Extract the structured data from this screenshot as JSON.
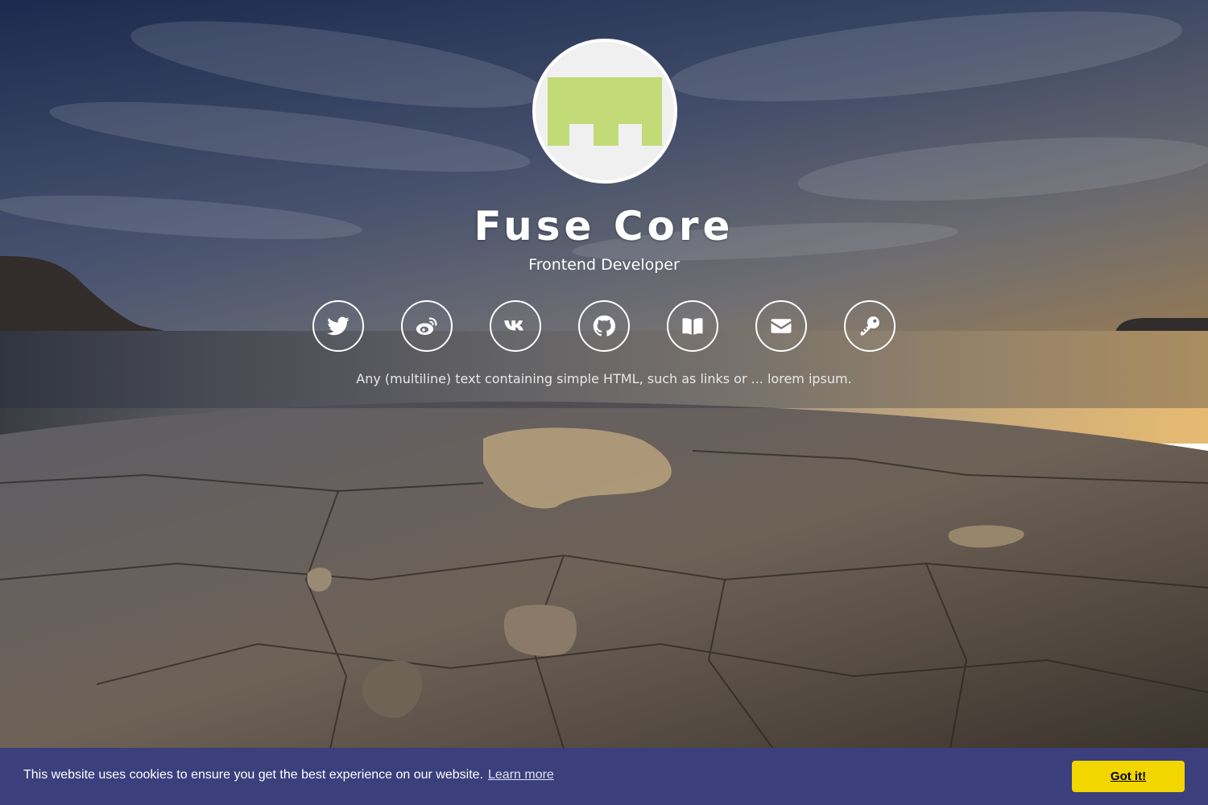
{
  "profile": {
    "name": "Fuse Core",
    "role": "Frontend Developer",
    "tagline": "Any (multiline) text containing simple HTML, such as links or ... lorem ipsum."
  },
  "social": [
    {
      "icon": "twitter-icon",
      "label": "Twitter"
    },
    {
      "icon": "weibo-icon",
      "label": "Weibo"
    },
    {
      "icon": "vk-icon",
      "label": "VK"
    },
    {
      "icon": "github-icon",
      "label": "GitHub"
    },
    {
      "icon": "book-icon",
      "label": "Book"
    },
    {
      "icon": "envelope-icon",
      "label": "Email"
    },
    {
      "icon": "key-icon",
      "label": "Key"
    }
  ],
  "cookie": {
    "message": "This website uses cookies to ensure you get the best experience on our website.",
    "learn_more": "Learn more",
    "accept": "Got it!"
  },
  "colors": {
    "avatar_logo": "#c2db77",
    "cookie_bar": "#3b3f7c",
    "cookie_button": "#f1d600"
  }
}
